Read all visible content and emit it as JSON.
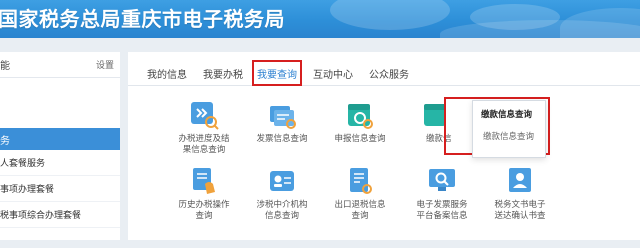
{
  "header": {
    "title": "国家税务总局重庆市电子税务局"
  },
  "sidebar": {
    "head_left": "能",
    "head_right": "设置",
    "section": "务",
    "items": [
      {
        "label": "人套餐服务"
      },
      {
        "label": "事项办理套餐"
      },
      {
        "label": "税事项综合办理套餐"
      }
    ]
  },
  "tabs": [
    {
      "label": "我的信息"
    },
    {
      "label": "我要办税"
    },
    {
      "label": "我要查询"
    },
    {
      "label": "互动中心"
    },
    {
      "label": "公众服务"
    }
  ],
  "tiles": [
    {
      "label_1": "办税进度及结",
      "label_2": "果信息查询",
      "icon": "progress-search-icon"
    },
    {
      "label_1": "发票信息查询",
      "label_2": "",
      "icon": "invoice-cards-icon"
    },
    {
      "label_1": "申报信息查询",
      "label_2": "",
      "icon": "declaration-folder-icon"
    },
    {
      "label_1": "缴款信",
      "label_2": "",
      "icon": "payment-folder-icon"
    },
    {
      "label_1": "历史办税操作",
      "label_2": "查询",
      "icon": "history-hand-icon"
    },
    {
      "label_1": "涉税中介机构",
      "label_2": "信息查询",
      "icon": "agency-id-card-icon"
    },
    {
      "label_1": "出口退税信息",
      "label_2": "查询",
      "icon": "export-refund-doc-icon"
    },
    {
      "label_1": "电子发票服务",
      "label_2": "平台备案信息",
      "icon": "e-invoice-monitor-icon"
    },
    {
      "label_1": "税务文书电子",
      "label_2": "送达确认书查",
      "icon": "tax-doc-person-icon"
    }
  ],
  "dropdown": {
    "title": "缴款信息查询",
    "item": "缴款信息查询"
  },
  "colors": {
    "banner": "#2d8fd8",
    "accent": "#3b8fd8",
    "highlight": "#d61f1f",
    "icon_blue": "#4a9de0",
    "icon_teal": "#26b5a6",
    "icon_orange": "#f0a23c"
  }
}
